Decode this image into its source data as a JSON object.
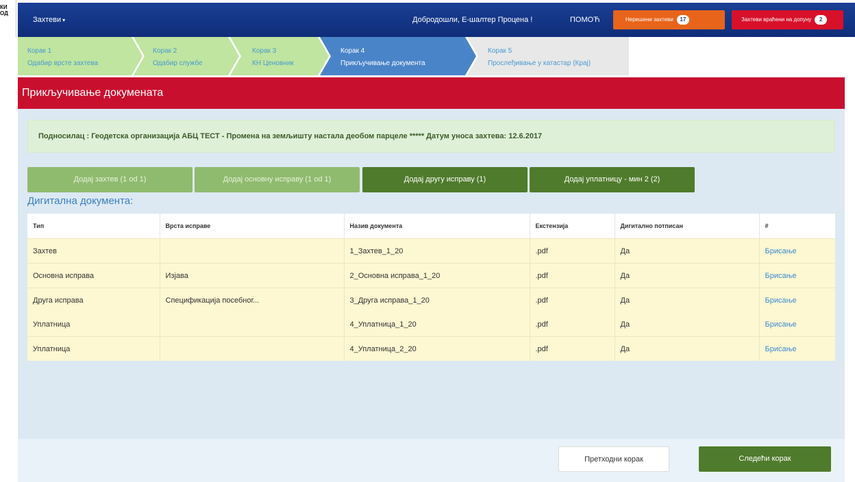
{
  "logo": {
    "line1": "КИ",
    "line2": "ОД"
  },
  "navbar": {
    "menu_label": "Захтеви",
    "caret": "▾",
    "welcome": "Добродошли, Е-шалтер Процена !",
    "help": "ПОМОЋ",
    "unhandled_label": "Нерешени захтеви",
    "unhandled_count": "17",
    "returned_label": "Захтеви враћени на допуну",
    "returned_count": "2",
    "colors": {
      "bar": "#1a3f95",
      "unhandled": "#e8641a",
      "returned": "#d8102a"
    }
  },
  "steps": [
    {
      "title": "Корак 1",
      "subtitle": "Одабир врсте захтева",
      "state": "done"
    },
    {
      "title": "Корак 2",
      "subtitle": "Одабир службе",
      "state": "done"
    },
    {
      "title": "Корак 3",
      "subtitle": "КН Ценовник",
      "state": "done"
    },
    {
      "title": "Корак 4",
      "subtitle": "Прикључивање документа",
      "state": "active"
    },
    {
      "title": "Корак 5",
      "subtitle": "Прослеђивање у катастар (Крај)",
      "state": "todo"
    }
  ],
  "panel": {
    "title": "Прикључивање докумената",
    "info": "Подносилац : Геодетска организација АБЦ ТЕСТ - Промена на земљишту настала деобом парцеле ***** Датум уноса захтева: 12.6.2017",
    "buttons": [
      {
        "label": "Додај захтев (1 od 1)",
        "enabled": false
      },
      {
        "label": "Додај основну исправу (1 od 1)",
        "enabled": false
      },
      {
        "label": "Додај другу исправу (1)",
        "enabled": true
      },
      {
        "label": "Додај уплатницу - мин 2 (2)",
        "enabled": true
      }
    ],
    "section_title": "Дигитална документа:",
    "table": {
      "headers": [
        "Тип",
        "Врста исправе",
        "Назив документа",
        "Екстензија",
        "Дигитално потписан",
        "#"
      ],
      "rows": [
        [
          "Захтев",
          "",
          "1_Захтев_1_20",
          ".pdf",
          "Да",
          "Брисање"
        ],
        [
          "Основна исправа",
          "Изјава",
          "2_Основна исправа_1_20",
          ".pdf",
          "Да",
          "Брисање"
        ],
        [
          "Друга исправа",
          "Спецификација посебног...",
          "3_Друга исправа_1_20",
          ".pdf",
          "Да",
          "Брисање"
        ],
        [
          "Уплатница",
          "",
          "4_Уплатница_1_20",
          ".pdf",
          "Да",
          "Брисање"
        ],
        [
          "Уплатница",
          "",
          "4_Уплатница_2_20",
          ".pdf",
          "Да",
          "Брисање"
        ]
      ]
    },
    "prev_label": "Претходни корак",
    "next_label": "Следећи корак"
  }
}
